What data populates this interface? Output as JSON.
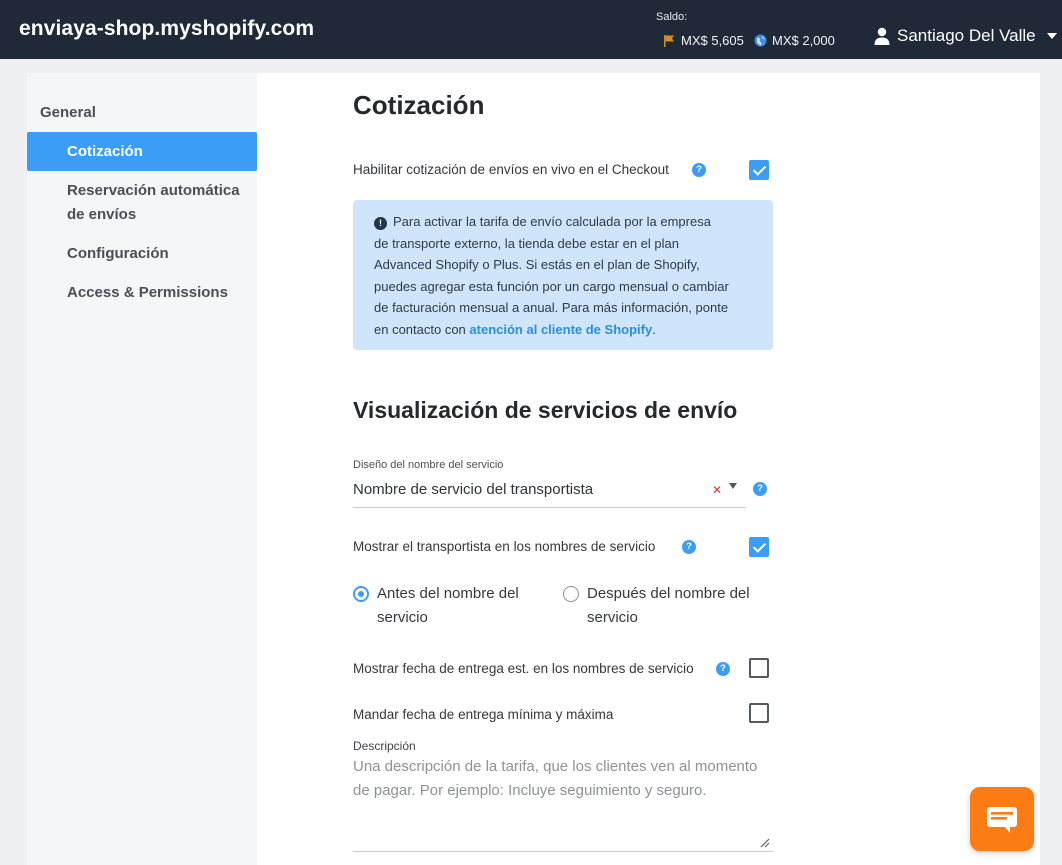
{
  "header": {
    "store": "enviaya-shop.myshopify.com",
    "saldo_label": "Saldo:",
    "balance_1": "MX$ 5,605",
    "balance_2": "MX$ 2,000",
    "user_name": "Santiago Del Valle"
  },
  "sidebar": {
    "items": [
      {
        "label": "General"
      },
      {
        "label": "Cotización",
        "active": true
      },
      {
        "label": "Reservación automática"
      },
      {
        "label": "de envíos"
      },
      {
        "label": "Configuración"
      },
      {
        "label": "Access & Permissions"
      }
    ]
  },
  "section1": {
    "title": "Cotización",
    "live_quote_label": "Habilitar cotización de envíos en vivo en el Checkout",
    "live_quote_checked": true,
    "info_lines": [
      "Para activar la tarifa de envío calculada por la empresa",
      "de transporte externo, la tienda debe estar en el plan",
      "Advanced Shopify o Plus. Si estás en el plan de Shopify,",
      "puedes agregar esta función por un cargo mensual o cambiar",
      "de facturación mensual a anual. Para más información, ponte",
      "en contacto con"
    ],
    "info_link": "atención al cliente de Shopify",
    "info_end": "."
  },
  "section2": {
    "title": "Visualización de servicios de envío",
    "select_caption": "Diseño del nombre del servicio",
    "select_value": "Nombre de servicio del transportista",
    "show_carrier_label": "Mostrar el transportista en los nombres de servicio",
    "show_carrier_checked": true,
    "radio_before_1": "Antes del nombre del",
    "radio_before_2": "servicio",
    "radio_after_1": "Después del nombre del",
    "radio_after_2": "servicio",
    "radio_selected": "before",
    "show_date_label": "Mostrar fecha de entrega est. en los nombres de servicio",
    "show_date_checked": false,
    "minmax_label": "Mandar fecha de entrega mínima y máxima",
    "minmax_checked": false,
    "desc_caption": "Descripción",
    "desc_placeholder": "Una descripción de la tarifa, que los clientes ven al momento de pagar. Por ejemplo: Incluye seguimiento y seguro."
  },
  "colors": {
    "topbar": "#1f2937",
    "accent": "#3b9df5",
    "info_bg": "#cfe5fb",
    "chat": "#fb7c15"
  }
}
